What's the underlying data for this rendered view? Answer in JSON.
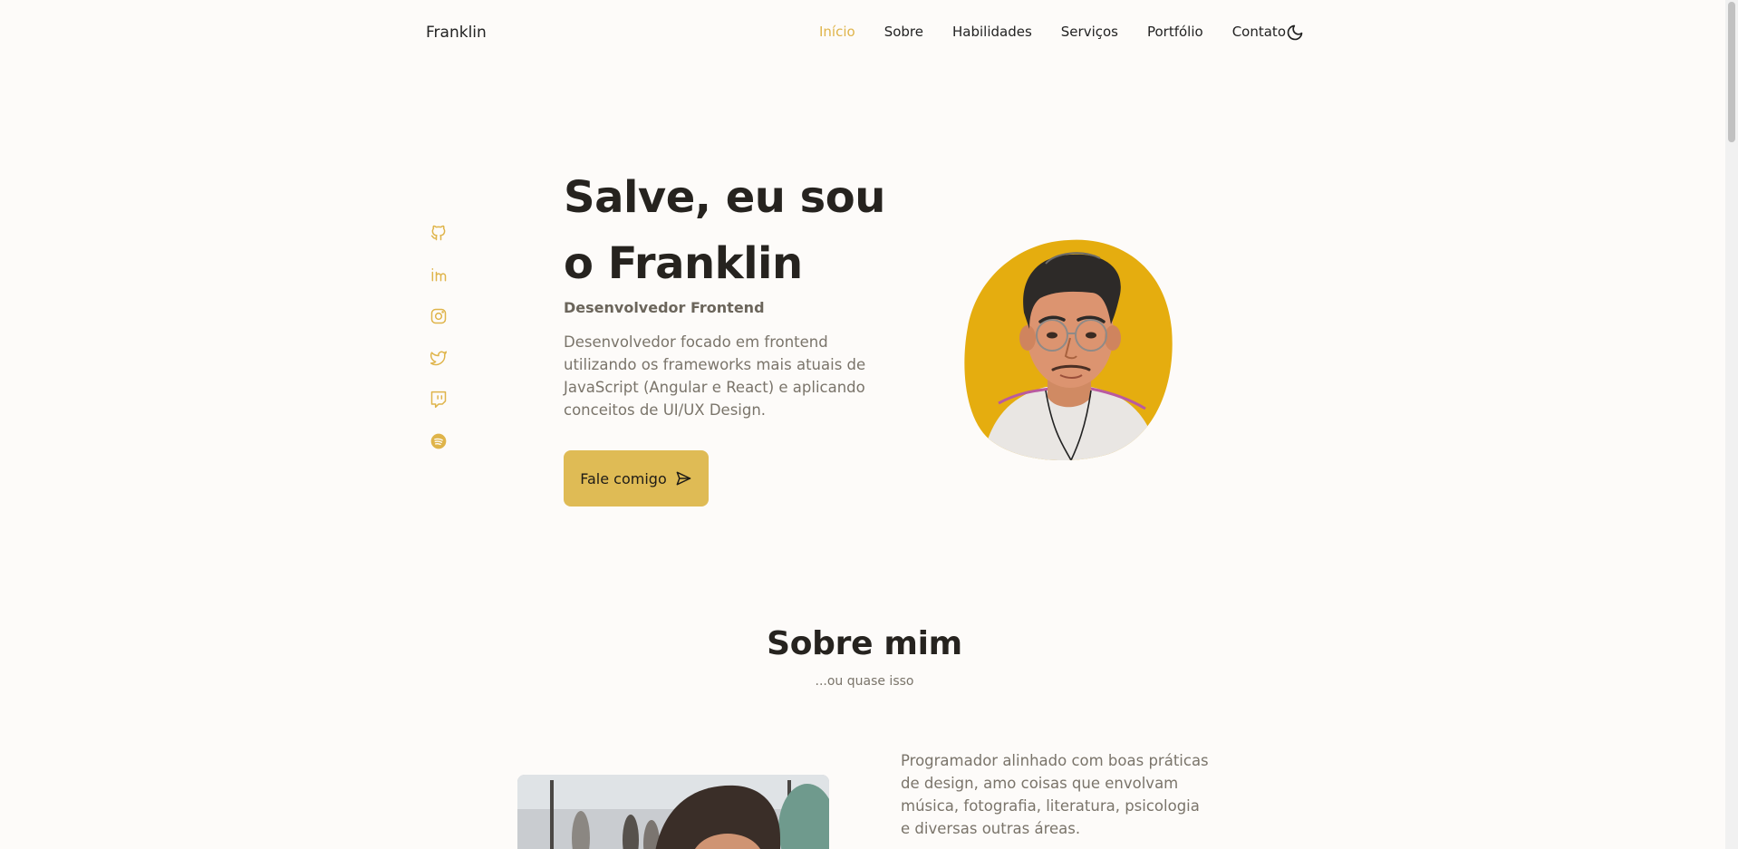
{
  "header": {
    "logo": "Franklin",
    "nav": [
      {
        "label": "Início",
        "active": true
      },
      {
        "label": "Sobre"
      },
      {
        "label": "Habilidades"
      },
      {
        "label": "Serviços"
      },
      {
        "label": "Portfólio"
      },
      {
        "label": "Contato"
      }
    ],
    "theme_icon": "moon-icon"
  },
  "social": [
    "github-icon",
    "linkedin-icon",
    "instagram-icon",
    "twitter-icon",
    "twitch-icon",
    "spotify-icon"
  ],
  "hero": {
    "title_line1": "Salve, eu sou",
    "title_line2": "o Franklin",
    "subtitle": "Desenvolvedor Frontend",
    "description": "Desenvolvedor focado em frontend utilizando os frameworks mais atuais de JavaScript (Angular e React) e aplicando conceitos de UI/UX Design.",
    "cta_label": "Fale comigo",
    "cta_icon": "send-icon"
  },
  "about": {
    "title": "Sobre mim",
    "subtitle": "...ou quase isso",
    "text": "Programador alinhado com boas práticas de design, amo coisas que envolvam música, fotografia, literatura, psicologia e diversas outras áreas."
  },
  "colors": {
    "accent": "#dfbb55",
    "active_link": "#dfb44a",
    "avatar_bg": "#e5ad0f",
    "background": "#fdfbf9"
  }
}
